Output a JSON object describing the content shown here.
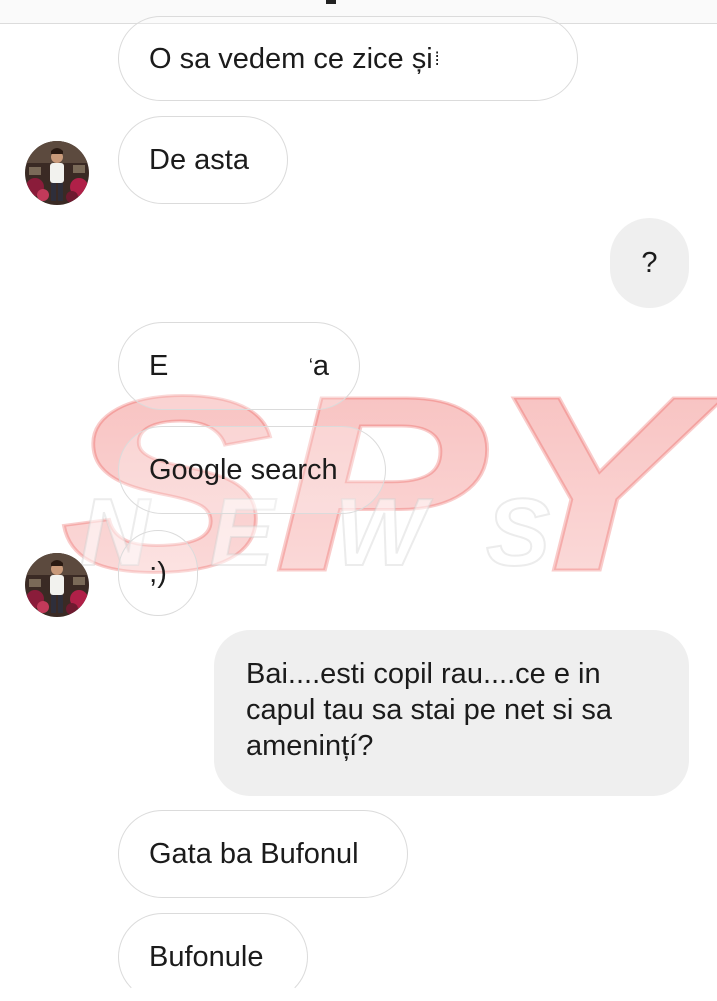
{
  "messages": [
    {
      "side": "in",
      "text": "O sa vedem ce zice și "
    },
    {
      "side": "in",
      "text": "De asta"
    },
    {
      "side": "out",
      "text": "?"
    },
    {
      "side": "in",
      "text_start": "E",
      "text_end": "a"
    },
    {
      "side": "in",
      "text": "Google search"
    },
    {
      "side": "in",
      "text": ";)"
    },
    {
      "side": "out",
      "text": "Bai....esti copil rau....ce e in capul tau sa stai pe net si sa amenințí?"
    },
    {
      "side": "in",
      "text": "Gata ba Bufonul"
    },
    {
      "side": "in",
      "text": "Bufonule"
    }
  ],
  "watermark": {
    "line1": "SPY",
    "line2": "NEWS"
  },
  "colors": {
    "incoming_border": "#dbdbdb",
    "outgoing_bg": "#efefef",
    "watermark_red": "#e8332f"
  },
  "icons": {
    "avatar": "contact-avatar"
  }
}
